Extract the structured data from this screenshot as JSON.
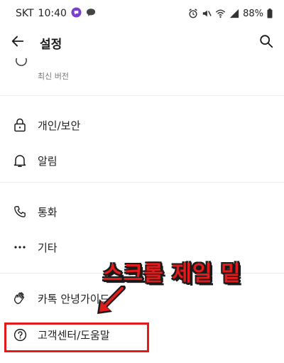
{
  "status_bar": {
    "carrier": "SKT",
    "time": "10:40",
    "battery": "88%",
    "icons": [
      "messenger-icon",
      "chat-bubble-icon",
      "alarm-icon",
      "mute-icon",
      "wifi-icon",
      "signal-icon",
      "battery-icon"
    ]
  },
  "app_bar": {
    "title": "설정",
    "icons": [
      "back-arrow-icon",
      "search-icon"
    ]
  },
  "version_item": {
    "sub": "최신 버전"
  },
  "menu": [
    {
      "label": "개인/보안",
      "icon": "lock-icon"
    },
    {
      "label": "알림",
      "icon": "bell-icon"
    },
    {
      "label": "통화",
      "icon": "phone-icon"
    },
    {
      "label": "기타",
      "icon": "more-dots-icon"
    },
    {
      "label": "카톡 안녕가이드",
      "icon": "wave-hand-icon"
    },
    {
      "label": "고객센터/도움말",
      "icon": "help-circle-icon"
    }
  ],
  "annotation": {
    "text": "스크롤 제일 밑",
    "color": "#e21a1a"
  },
  "colors": {
    "highlight": "#e21a1a",
    "divider": "#ebebeb",
    "text": "#1f1f1f",
    "subtext": "#777777"
  }
}
